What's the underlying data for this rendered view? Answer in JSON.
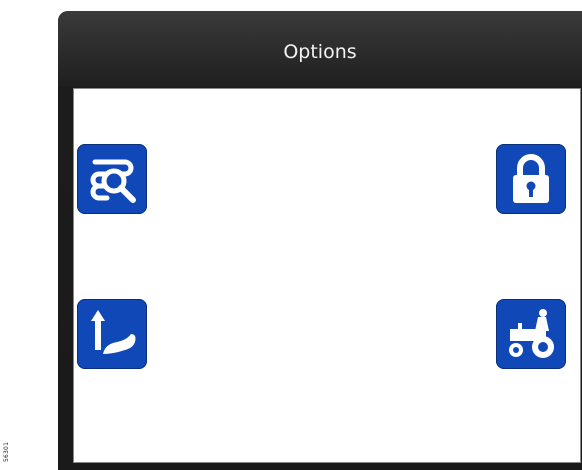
{
  "dialog": {
    "title": "Options"
  },
  "side_label": "56301",
  "buttons": [
    {
      "name": "search",
      "icon": "search-icon"
    },
    {
      "name": "lock",
      "icon": "lock-icon"
    },
    {
      "name": "upload",
      "icon": "upload-icon"
    },
    {
      "name": "tractor",
      "icon": "tractor-icon"
    }
  ],
  "colors": {
    "tile_blue": "#1148b8",
    "header_dark": "#1f1f1f"
  }
}
